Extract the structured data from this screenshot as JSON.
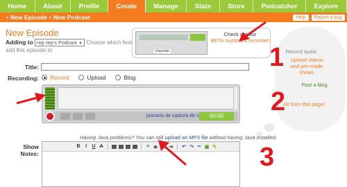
{
  "nav": {
    "tabs": [
      {
        "label": "Home",
        "active": false
      },
      {
        "label": "About",
        "active": false
      },
      {
        "label": "Profile",
        "active": false
      },
      {
        "label": "Create",
        "active": true
      },
      {
        "label": "Manage",
        "active": false
      },
      {
        "label": "Stats",
        "active": false
      },
      {
        "label": "Store",
        "active": false
      },
      {
        "label": "Podcatcher",
        "active": false
      },
      {
        "label": "Explore",
        "active": false
      }
    ],
    "sub": {
      "new_episode": "New Episode",
      "new_podcast": "New Podcast"
    },
    "help": "Help",
    "report": "Report a bug"
  },
  "page": {
    "title": "New Episode",
    "adding_label": "Adding to",
    "podcast_select": "rep rep's Podcast",
    "choose_hint": "Choose which feed to add this episode to"
  },
  "promo": {
    "line1": "Check out our",
    "link": "BETA multitrack recorder!",
    "thumb_label": "importar"
  },
  "form": {
    "title_label": "Title:",
    "recording_label": "Recording:",
    "options": [
      "Record",
      "Upload",
      "Blog"
    ],
    "selected": "Record",
    "device_label": "primario de captura de sonido",
    "timer": "00:00",
    "java_text_before": "Having Java problems? You can still ",
    "java_link": "upload an MP3 file",
    "java_text_after": " without having Java installed.",
    "show_notes_label": "Show Notes:"
  },
  "tips": {
    "record": "Record audio",
    "upload": "Upload videos and pre-made shows",
    "blog": "Post a blog",
    "all": "All from this page!",
    "numbers": [
      "1",
      "2",
      "3"
    ]
  },
  "colors": {
    "nav_green": "#9aca3c",
    "accent_orange": "#f47b20",
    "annotation_red": "#e0191e"
  }
}
